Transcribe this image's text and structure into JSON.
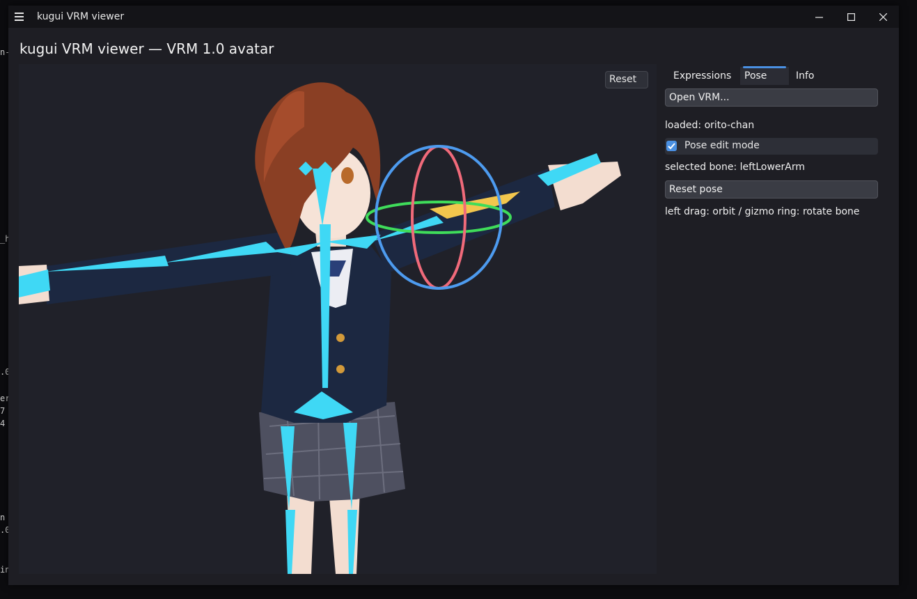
{
  "window": {
    "title": "kugui VRM viewer",
    "menu_icon": "hamburger-menu-icon",
    "minimize_icon": "minimize-icon",
    "maximize_icon": "maximize-icon",
    "close_icon": "close-icon"
  },
  "app": {
    "heading": "kugui VRM viewer — VRM 1.0 avatar"
  },
  "viewport": {
    "reset_label": "Reset",
    "gizmo_colors": {
      "ring_x": "#f06a7a",
      "ring_y": "#3fdc5a",
      "ring_z": "#4d9bef",
      "bones": "#3fd8f5",
      "selected_bone": "#f2c64d"
    }
  },
  "panel": {
    "tabs": [
      {
        "label": "Expressions",
        "active": false
      },
      {
        "label": "Pose",
        "active": true
      },
      {
        "label": "Info",
        "active": false
      }
    ],
    "open_vrm_label": "Open VRM...",
    "loaded_text": "loaded: orito-chan",
    "pose_edit_label": "Pose edit mode",
    "pose_edit_checked": true,
    "selected_bone_text": "selected bone: leftLowerArm",
    "reset_pose_label": "Reset pose",
    "hint_text": "left drag: orbit / gizmo ring: rotate bone"
  },
  "background_terminal": {
    "fragments": [
      "n-",
      "_h",
      ".0",
      "er",
      "7",
      "4",
      "n",
      ".0",
      "in"
    ]
  }
}
